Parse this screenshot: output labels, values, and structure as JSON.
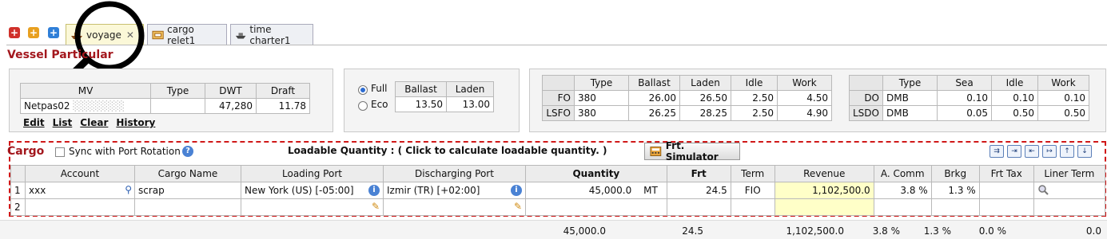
{
  "tabs": [
    {
      "label": "voyage",
      "active": true
    },
    {
      "label": "cargo relet1",
      "active": false
    },
    {
      "label": "time charter1",
      "active": false
    }
  ],
  "tab_buttons": [
    "+",
    "+",
    "+"
  ],
  "vessel": {
    "title": "Vessel Particular",
    "headers": [
      "MV",
      "Type",
      "DWT",
      "Draft"
    ],
    "row": {
      "mv": "Netpas02",
      "type": "",
      "dwt": "47,280",
      "draft": "11.78"
    },
    "links": [
      "Edit",
      "List",
      "Clear",
      "History"
    ]
  },
  "speed": {
    "options": [
      "Full",
      "Eco"
    ],
    "selected": "Full",
    "headers": [
      "Ballast",
      "Laden"
    ],
    "full": {
      "ballast": "",
      "laden": ""
    },
    "eco": {
      "ballast": "13.50",
      "laden": "13.00"
    }
  },
  "fuel": {
    "headers": [
      "Type",
      "Ballast",
      "Laden",
      "Idle",
      "Work"
    ],
    "rows": [
      {
        "name": "FO",
        "type": "380",
        "ballast": "26.00",
        "laden": "26.50",
        "idle": "2.50",
        "work": "4.50"
      },
      {
        "name": "LSFO",
        "type": "380",
        "ballast": "26.25",
        "laden": "28.25",
        "idle": "2.50",
        "work": "4.90"
      }
    ]
  },
  "diesel": {
    "headers": [
      "Type",
      "Sea",
      "Idle",
      "Work"
    ],
    "rows": [
      {
        "name": "DO",
        "type": "DMB",
        "sea": "0.10",
        "idle": "0.10",
        "work": "0.10"
      },
      {
        "name": "LSDO",
        "type": "DMB",
        "sea": "0.05",
        "idle": "0.50",
        "work": "0.50"
      }
    ]
  },
  "cargo": {
    "title": "Cargo",
    "sync_label": "Sync with Port Rotation",
    "loadable_label": "Loadable Quantity :  ( Click to calculate loadable quantity. )",
    "simulator_label": "Frt. Simulator",
    "headers": [
      "Account",
      "Cargo Name",
      "Loading Port",
      "Discharging Port",
      "Quantity",
      "Frt",
      "Term",
      "Revenue",
      "A. Comm",
      "Brkg",
      "Frt Tax",
      "Liner Term"
    ],
    "rows": [
      {
        "no": "1",
        "account": "xxx",
        "cargo": "scrap",
        "loading": "New York (US) [-05:00]",
        "discharging": "Izmir (TR) [+02:00]",
        "quantity": "45,000.0",
        "unit": "MT",
        "frt": "24.5",
        "term": "FIO",
        "revenue": "1,102,500.0",
        "acomm": "3.8 %",
        "brkg": "1.3 %",
        "frttax": ""
      },
      {
        "no": "2",
        "account": "",
        "cargo": "",
        "loading": "",
        "discharging": "",
        "quantity": "",
        "unit": "",
        "frt": "",
        "term": "",
        "revenue": "",
        "acomm": "",
        "brkg": "",
        "frttax": ""
      }
    ],
    "totals": {
      "quantity": "45,000.0",
      "frt": "24.5",
      "revenue": "1,102,500.0",
      "acomm": "3.8 %",
      "brkg": "1.3 %",
      "frttax": "0.0 %",
      "last": "0.0"
    }
  },
  "colors": {
    "section": "#a3171d",
    "dash": "#d01818",
    "highlight": "#ffffc8"
  }
}
